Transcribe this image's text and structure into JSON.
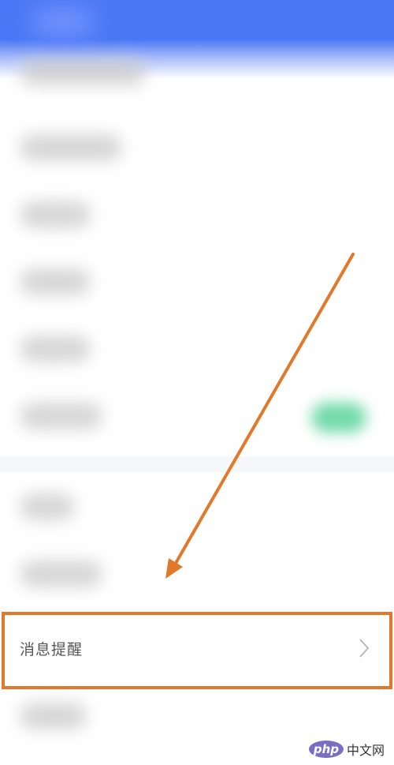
{
  "settings_row": {
    "label": "消息提醒"
  },
  "watermark": {
    "logo": "php",
    "text": "中文网"
  },
  "colors": {
    "header_blue": "#4a78f5",
    "highlight_orange": "#e2782a",
    "toggle_green": "#59d49a"
  },
  "icons": {
    "row_chevron": "chevron-right-icon",
    "annotation": "arrow-annotation-icon"
  }
}
